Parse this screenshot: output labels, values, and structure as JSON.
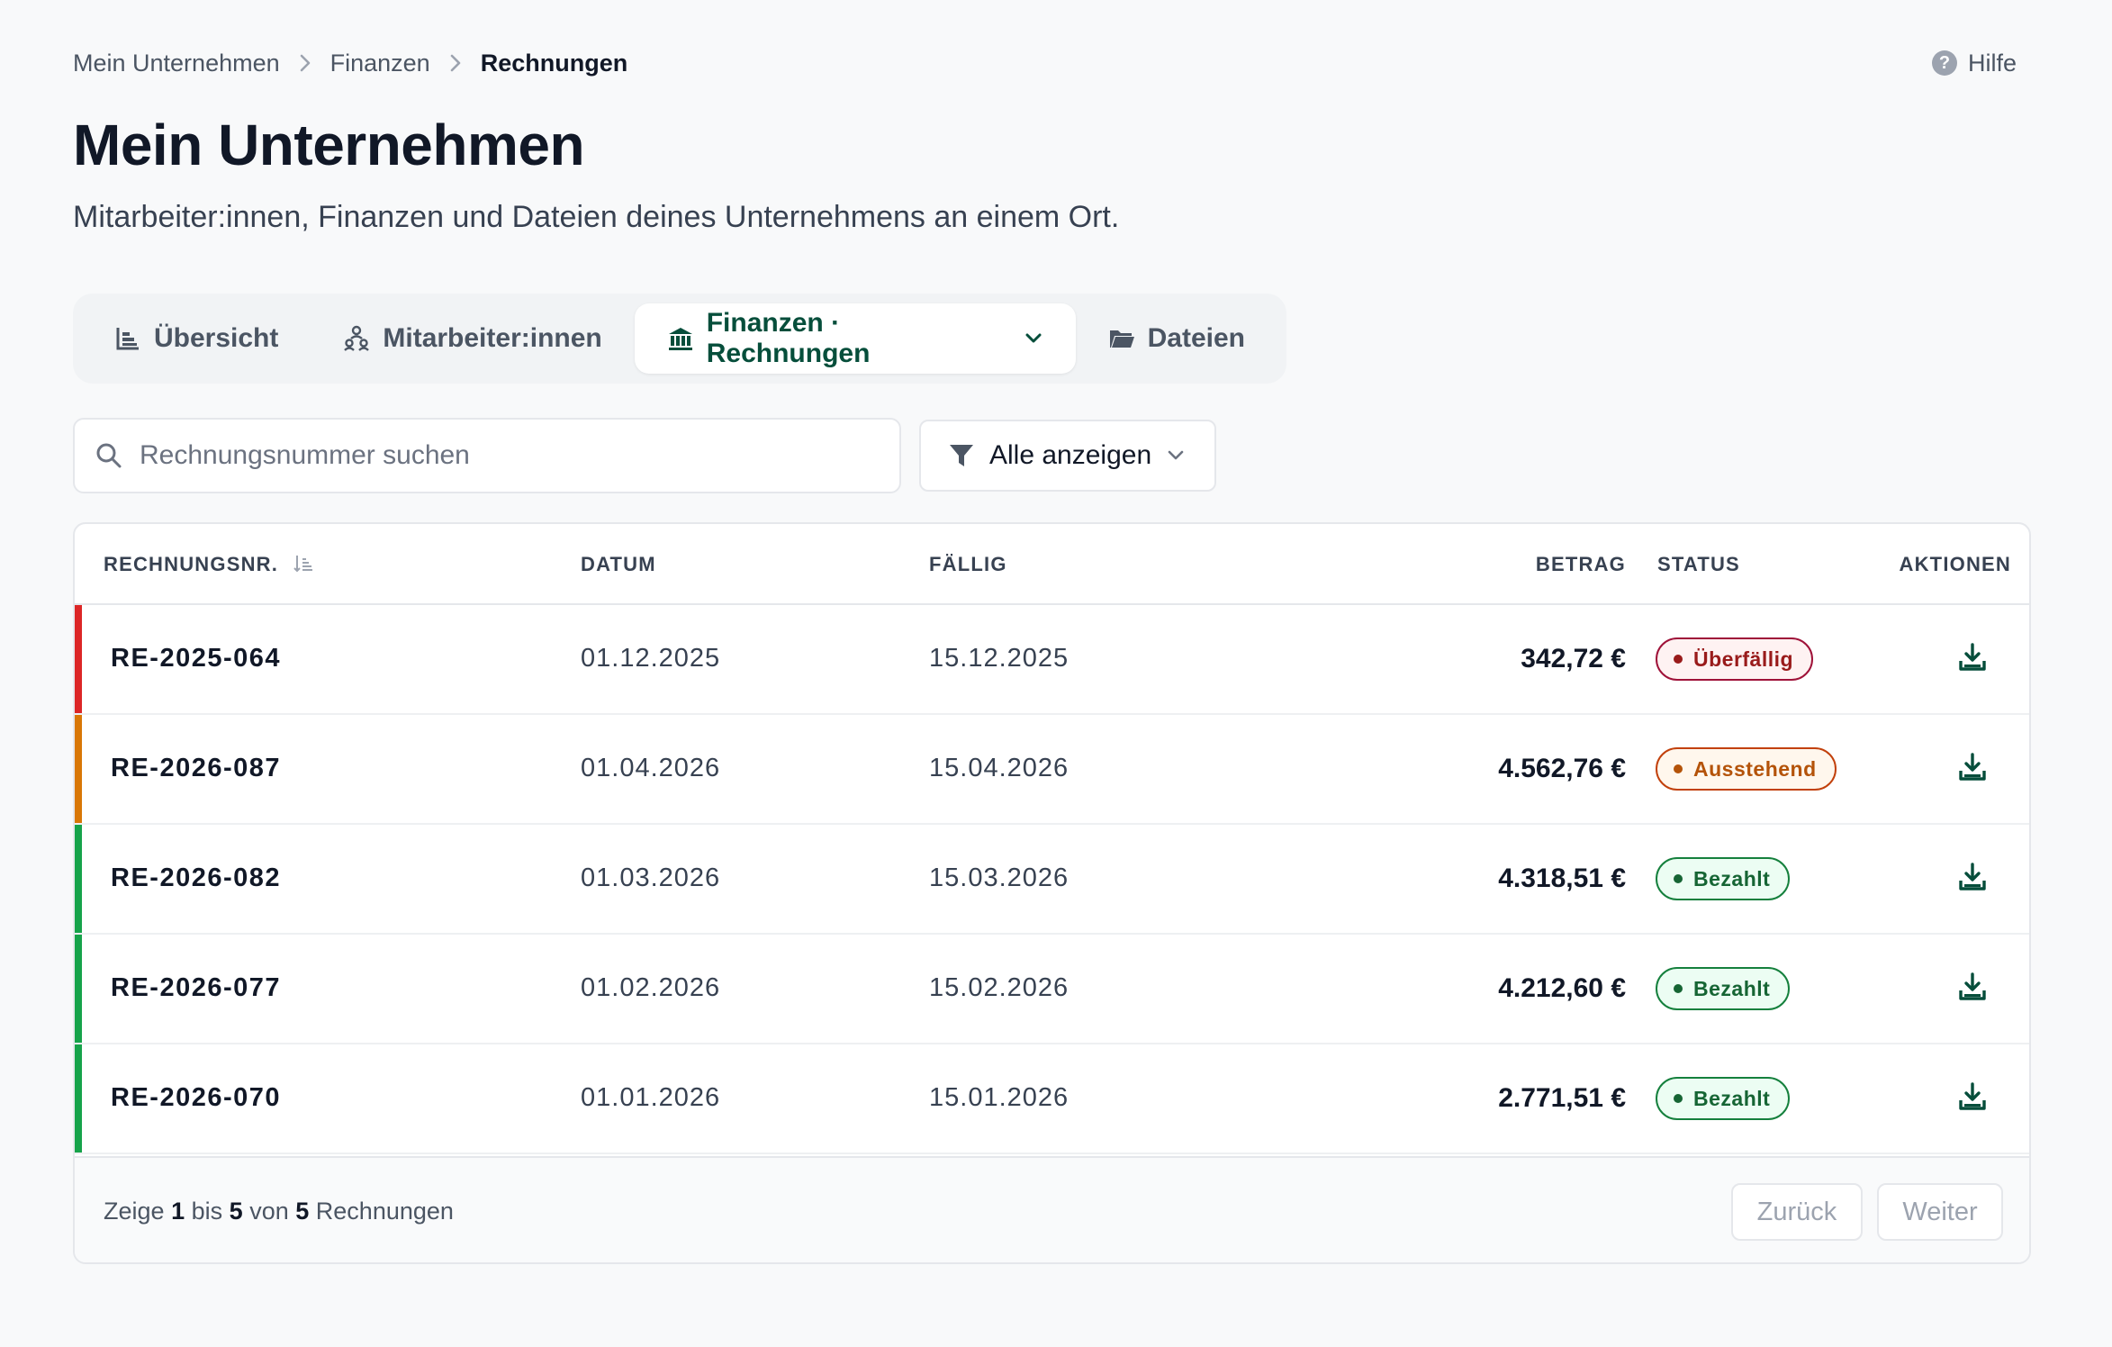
{
  "breadcrumb": [
    "Mein Unternehmen",
    "Finanzen",
    "Rechnungen"
  ],
  "help_label": "Hilfe",
  "help_icon_glyph": "?",
  "page_title": "Mein Unternehmen",
  "page_subtitle": "Mitarbeiter:innen, Finanzen und Dateien deines Unternehmens an einem Ort.",
  "tabs": [
    {
      "label": "Übersicht",
      "icon": "chart-icon"
    },
    {
      "label": "Mitarbeiter:innen",
      "icon": "people-icon"
    },
    {
      "label": "Finanzen · Rechnungen",
      "icon": "bank-icon",
      "active": true
    },
    {
      "label": "Dateien",
      "icon": "folder-icon"
    }
  ],
  "search": {
    "placeholder": "Rechnungsnummer suchen",
    "value": ""
  },
  "filter": {
    "label": "Alle anzeigen"
  },
  "table": {
    "headers": {
      "invoice": "RECHNUNGSNR.",
      "date": "DATUM",
      "due": "FÄLLIG",
      "amount": "BETRAG",
      "status": "STATUS",
      "actions": "AKTIONEN"
    },
    "rows": [
      {
        "invoice": "RE-2025-064",
        "date": "01.12.2025",
        "due": "15.12.2025",
        "amount": "342,72 €",
        "status": "Überfällig",
        "status_type": "overdue"
      },
      {
        "invoice": "RE-2026-087",
        "date": "01.04.2026",
        "due": "15.04.2026",
        "amount": "4.562,76 €",
        "status": "Ausstehend",
        "status_type": "pending"
      },
      {
        "invoice": "RE-2026-082",
        "date": "01.03.2026",
        "due": "15.03.2026",
        "amount": "4.318,51 €",
        "status": "Bezahlt",
        "status_type": "paid"
      },
      {
        "invoice": "RE-2026-077",
        "date": "01.02.2026",
        "due": "15.02.2026",
        "amount": "4.212,60 €",
        "status": "Bezahlt",
        "status_type": "paid"
      },
      {
        "invoice": "RE-2026-070",
        "date": "01.01.2026",
        "due": "15.01.2026",
        "amount": "2.771,51 €",
        "status": "Bezahlt",
        "status_type": "paid"
      }
    ]
  },
  "pagination": {
    "prefix": "Zeige",
    "from": "1",
    "to_word": "bis",
    "to": "5",
    "of_word": "von",
    "total": "5",
    "suffix": "Rechnungen",
    "prev_label": "Zurück",
    "next_label": "Weiter"
  },
  "colors": {
    "accent": "#064e3b",
    "overdue_bar": "#dc2626",
    "pending_bar": "#d97706",
    "paid_bar": "#16a34a",
    "overdue_badge_text": "#991b1b",
    "overdue_badge_bg": "#fef2f2",
    "overdue_badge_border": "#9f1239",
    "pending_badge_text": "#b45309",
    "pending_badge_bg": "#fff7ed",
    "pending_badge_border": "#c2410c",
    "paid_badge_text": "#166534",
    "paid_badge_bg": "#ecfdf3",
    "paid_badge_border": "#15803d"
  }
}
